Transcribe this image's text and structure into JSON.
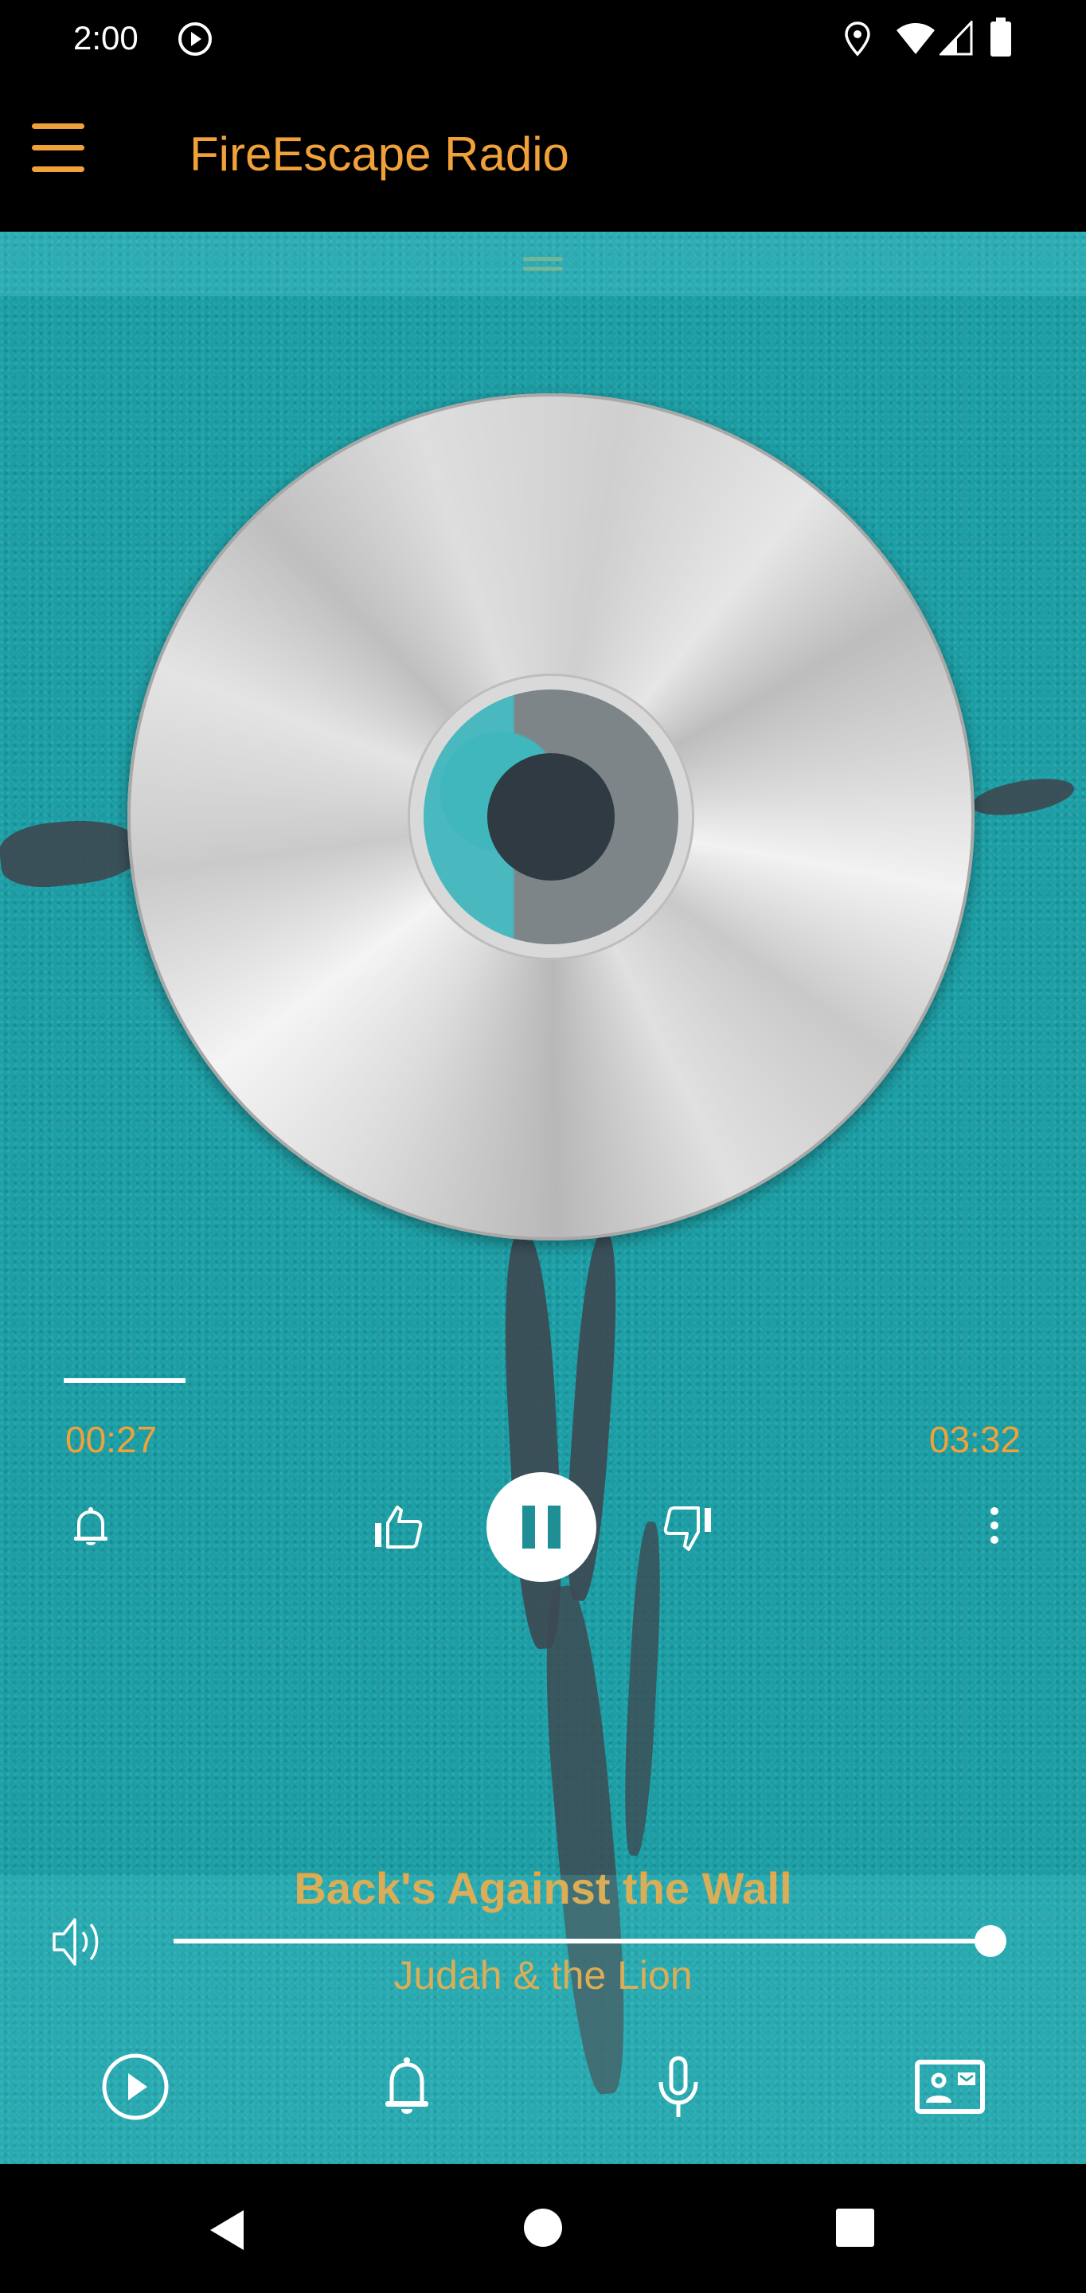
{
  "status_bar": {
    "time": "2:00",
    "icons": [
      "media-play-notification-icon",
      "location-icon",
      "wifi-icon",
      "cell-signal-icon",
      "battery-icon"
    ]
  },
  "app_bar": {
    "menu_icon": "hamburger-menu-icon",
    "title": "FireEscape Radio"
  },
  "colors": {
    "accent": "#f0a13a",
    "background_teal": "#1b9ea5",
    "bars": "#000000",
    "icons": "#ffffff"
  },
  "player": {
    "album_art": "cd-disc",
    "progress": {
      "elapsed": "00:27",
      "total": "03:32",
      "fraction": 0.127
    },
    "controls": {
      "alarm": "bell-icon",
      "like": "thumbs-up-icon",
      "play_state": "playing",
      "primary": "pause-icon",
      "dislike": "thumbs-down-icon",
      "more": "overflow-menu-icon"
    },
    "track": {
      "title": "Back's Against the Wall",
      "artist": "Judah & the Lion"
    }
  },
  "volume": {
    "icon": "volume-icon",
    "level": 1.0
  },
  "bottom_nav": [
    {
      "name": "play",
      "icon": "play-circle-icon"
    },
    {
      "name": "alerts",
      "icon": "bell-icon"
    },
    {
      "name": "voice",
      "icon": "microphone-icon"
    },
    {
      "name": "contact",
      "icon": "contact-card-icon"
    }
  ],
  "system_nav": [
    "back",
    "home",
    "recents"
  ]
}
